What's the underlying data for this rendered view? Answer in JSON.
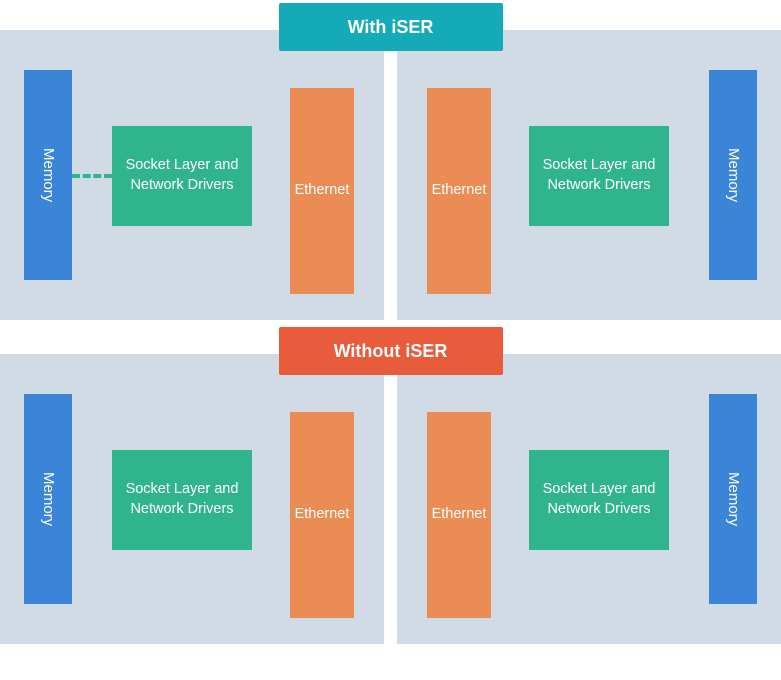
{
  "titles": {
    "with": "With iSER",
    "without": "Without iSER"
  },
  "labels": {
    "memory": "Memory",
    "socket": "Socket Layer and Network Drivers",
    "ethernet": "Ethernet"
  },
  "colors": {
    "panel_bg": "#d1dbe5",
    "memory": "#3a85d8",
    "socket": "#30b48b",
    "ethernet": "#ec8c55",
    "title_with": "#14aab8",
    "title_without": "#e85b3b"
  }
}
